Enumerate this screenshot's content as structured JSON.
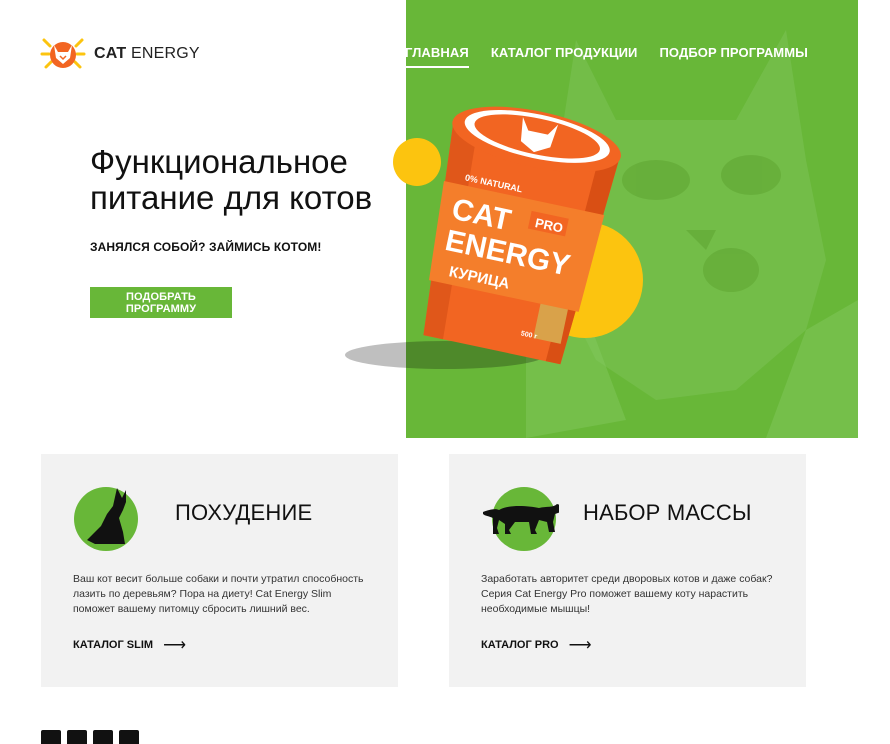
{
  "header": {
    "logo_bold": "CAT",
    "logo_light": "ENERGY",
    "logo_icon": "cat-logo-icon",
    "nav": [
      {
        "label": "ГЛАВНАЯ",
        "active": true
      },
      {
        "label": "КАТАЛОГ ПРОДУКЦИИ",
        "active": false
      },
      {
        "label": "ПОДБОР ПРОГРАММЫ",
        "active": false
      }
    ]
  },
  "hero": {
    "title": "Функциональное питание для котов",
    "subtitle": "ЗАНЯЛСЯ СОБОЙ? ЗАЙМИСЬ КОТОМ!",
    "button": "ПОДОБРАТЬ ПРОГРАММУ",
    "product": {
      "natural": "0% NATURAL",
      "brand_line1": "CAT",
      "brand_pro": "PRO",
      "brand_line2": "ENERGY",
      "flavor": "КУРИЦА",
      "weight": "500 г"
    }
  },
  "cards": [
    {
      "title": "ПОХУДЕНИЕ",
      "icon": "sitting-cat-icon",
      "description": "Ваш кот весит больше собаки и почти утратил способность лазить по деревьям? Пора на диету! Cat Energy Slim поможет вашему питомцу сбросить лишний вес.",
      "link": "КАТАЛОГ SLIM",
      "arrow": "⟶"
    },
    {
      "title": "НАБОР МАССЫ",
      "icon": "panther-icon",
      "description": "Заработать авторитет среди дворовых котов и даже собак? Серия Cat Energy Pro поможет вашему коту нарастить необходимые мышцы!",
      "link": "КАТАЛОГ PRO",
      "arrow": "⟶"
    }
  ],
  "colors": {
    "accent": "#68b738",
    "orange": "#f26522",
    "yellow": "#fcc40f",
    "card_bg": "#f2f2f2"
  }
}
